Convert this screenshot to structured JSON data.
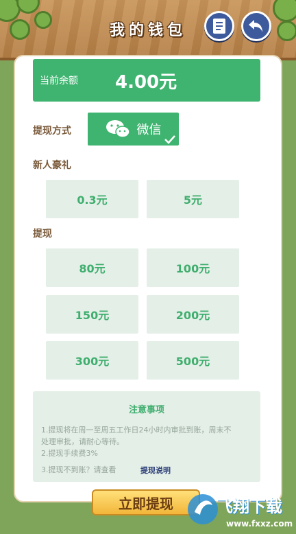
{
  "header": {
    "title": "我的钱包",
    "notes_icon": "notes-icon",
    "back_icon": "back-arrow-icon"
  },
  "balance": {
    "label": "当前余额",
    "value": "4.00元"
  },
  "method": {
    "label": "提现方式",
    "option": "微信",
    "icon": "wechat-icon",
    "selected": true
  },
  "newbie": {
    "label": "新人豪礼",
    "options": [
      "0.3元",
      "5元"
    ]
  },
  "withdraw": {
    "label": "提现",
    "options": [
      "80元",
      "100元",
      "150元",
      "200元",
      "300元",
      "500元"
    ]
  },
  "notice": {
    "title": "注意事项",
    "line1": "1.提现将在周一至周五工作日24小时内审批到账，周末不",
    "line2": "处理审批，请耐心等待。",
    "line3": "2.提现手续费3%",
    "line4": "3.提现不到账？请查看",
    "link": "提现说明"
  },
  "action_button": "立即提现",
  "watermark": {
    "text": "飞翔下载",
    "sub": "www.fxxz.com"
  },
  "colors": {
    "accent": "#3fb470",
    "option_bg": "#e4efe7",
    "label": "#7a5a3a",
    "header": "#c9955a"
  }
}
